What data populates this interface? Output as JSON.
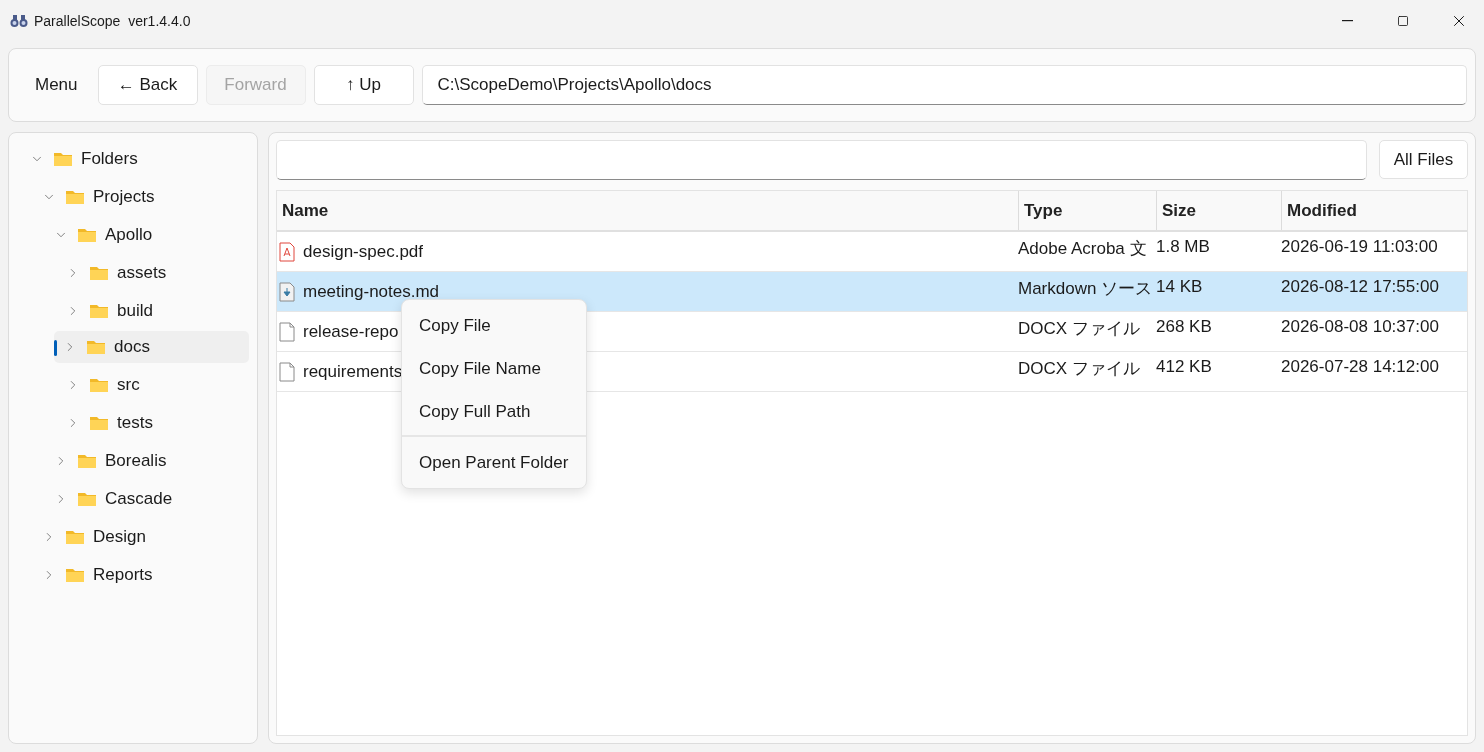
{
  "window": {
    "title": "ParallelScope  ver1.4.4.0"
  },
  "toolbar": {
    "menu": "Menu",
    "buttons": [
      {
        "label": "← Back",
        "disabled": false
      },
      {
        "label": "Forward",
        "disabled": true
      },
      {
        "label": "↑ Up",
        "disabled": false
      }
    ],
    "path": "C:\\ScopeDemo\\Projects\\Apollo\\docs"
  },
  "tree": [
    {
      "label": "Folders",
      "expanded": true,
      "selected": false,
      "children": [
        {
          "label": "Projects",
          "expanded": true,
          "selected": false,
          "children": [
            {
              "label": "Apollo",
              "expanded": true,
              "selected": false,
              "children": [
                {
                  "label": "assets",
                  "expanded": false,
                  "selected": false
                },
                {
                  "label": "build",
                  "expanded": false,
                  "selected": false
                },
                {
                  "label": "docs",
                  "expanded": false,
                  "selected": true
                },
                {
                  "label": "src",
                  "expanded": false,
                  "selected": false
                },
                {
                  "label": "tests",
                  "expanded": false,
                  "selected": false
                }
              ]
            },
            {
              "label": "Borealis",
              "expanded": false,
              "selected": false
            },
            {
              "label": "Cascade",
              "expanded": false,
              "selected": false
            }
          ]
        },
        {
          "label": "Design",
          "expanded": false,
          "selected": false
        },
        {
          "label": "Reports",
          "expanded": false,
          "selected": false
        }
      ]
    }
  ],
  "filter": {
    "button": "All Files"
  },
  "table": {
    "columns": [
      "Name",
      "Type",
      "Size",
      "Modified"
    ],
    "rows": [
      {
        "kind": "pdf",
        "selected": false,
        "name": "design-spec.pdf",
        "type": "Adobe Acroba 文",
        "size": "1.8 MB",
        "modified": "2026-06-19 11:03:00"
      },
      {
        "kind": "markdown",
        "selected": true,
        "name": "meeting-notes.md",
        "type": "Markdown ソース",
        "size": "14 KB",
        "modified": "2026-08-12 17:55:00"
      },
      {
        "kind": "document",
        "selected": false,
        "name": "release-repo",
        "type": "DOCX ファイル",
        "size": "268 KB",
        "modified": "2026-08-08 10:37:00"
      },
      {
        "kind": "document",
        "selected": false,
        "name": "requirements",
        "type": "DOCX ファイル",
        "size": "412 KB",
        "modified": "2026-07-28 14:12:00"
      }
    ]
  },
  "context_menu": {
    "groups": [
      [
        "Copy File",
        "Copy File Name",
        "Copy Full Path"
      ],
      [
        "Open Parent Folder"
      ]
    ]
  }
}
